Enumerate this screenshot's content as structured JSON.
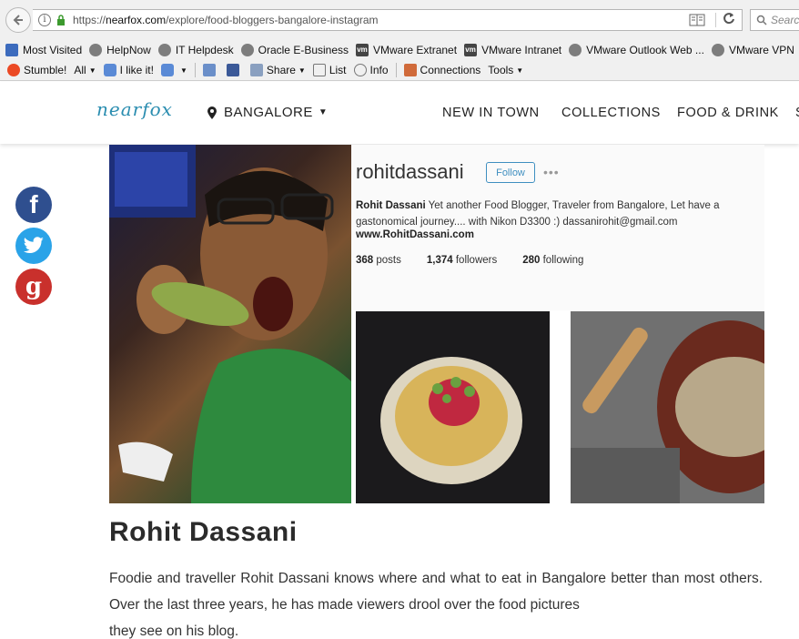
{
  "browser": {
    "url_prefix": "https://",
    "url_domain": "nearfox.com",
    "url_path": "/explore/food-bloggers-bangalore-instagram",
    "search_placeholder": "Searc",
    "bookmarks": [
      "Most Visited",
      "HelpNow",
      "IT Helpdesk",
      "Oracle E-Business",
      "VMware Extranet",
      "VMware Intranet",
      "VMware Outlook Web ...",
      "VMware VPN"
    ],
    "toolbar": {
      "stumble": "Stumble!",
      "all": "All",
      "ilike": "I like it!",
      "share": "Share",
      "list": "List",
      "info": "Info",
      "connections": "Connections",
      "tools": "Tools"
    }
  },
  "site": {
    "logo": "nearfox",
    "city": "BANGALORE",
    "nav": [
      "NEW IN TOWN",
      "COLLECTIONS",
      "FOOD & DRINK",
      "S"
    ]
  },
  "social": {
    "facebook_glyph": "f",
    "google_glyph": "g"
  },
  "instagram": {
    "handle": "rohitdassani",
    "follow": "Follow",
    "more": "•••",
    "bio_name": "Rohit Dassani",
    "bio_text": " Yet another Food Blogger, Traveler from Bangalore, Let have a gastonomical journey.... with Nikon D3300 :) dassanirohit@gmail.com",
    "link": "www.RohitDassani.com",
    "posts_count": "368",
    "posts_label": " posts",
    "followers_count": "1,374",
    "followers_label": " followers",
    "following_count": "280",
    "following_label": " following"
  },
  "article": {
    "title": "Rohit Dassani",
    "body_line1": "Foodie and traveller Rohit Dassani knows where and what to eat in Bangalore better than most others. Over the last three years, he has made viewers drool over the food pictures",
    "body_line2": "they see on his blog."
  },
  "colors": {
    "accent": "#2a8db0",
    "facebook": "#2f4f8f",
    "twitter": "#2aa3e8",
    "google": "#c9302c"
  }
}
